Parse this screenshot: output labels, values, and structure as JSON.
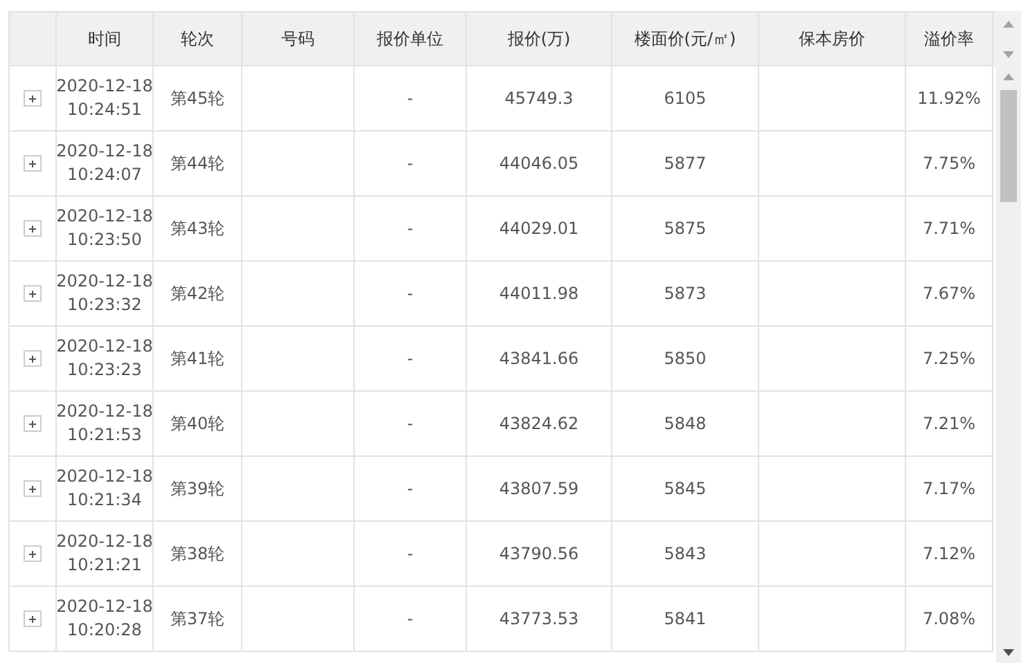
{
  "table": {
    "columns": [
      "时间",
      "轮次",
      "号码",
      "报价单位",
      "报价(万)",
      "楼面价(元/㎡)",
      "保本房价",
      "溢价率"
    ],
    "rows": [
      {
        "expanded": false,
        "time": "2020-12-18\n10:24:51",
        "round": "第45轮",
        "bidder": "-",
        "bid": "45749.3",
        "floor_price": "6105",
        "premium": "11.92%"
      },
      {
        "expanded": false,
        "time": "2020-12-18\n10:24:07",
        "round": "第44轮",
        "bidder": "-",
        "bid": "44046.05",
        "floor_price": "5877",
        "premium": "7.75%"
      },
      {
        "expanded": false,
        "time": "2020-12-18\n10:23:50",
        "round": "第43轮",
        "bidder": "-",
        "bid": "44029.01",
        "floor_price": "5875",
        "premium": "7.71%"
      },
      {
        "expanded": false,
        "time": "2020-12-18\n10:23:32",
        "round": "第42轮",
        "bidder": "-",
        "bid": "44011.98",
        "floor_price": "5873",
        "premium": "7.67%"
      },
      {
        "expanded": false,
        "time": "2020-12-18\n10:23:23",
        "round": "第41轮",
        "bidder": "-",
        "bid": "43841.66",
        "floor_price": "5850",
        "premium": "7.25%"
      },
      {
        "expanded": false,
        "time": "2020-12-18\n10:21:53",
        "round": "第40轮",
        "bidder": "-",
        "bid": "43824.62",
        "floor_price": "5848",
        "premium": "7.21%"
      },
      {
        "expanded": false,
        "time": "2020-12-18\n10:21:34",
        "round": "第39轮",
        "bidder": "-",
        "bid": "43807.59",
        "floor_price": "5845",
        "premium": "7.17%"
      },
      {
        "expanded": false,
        "time": "2020-12-18\n10:21:21",
        "round": "第38轮",
        "bidder": "-",
        "bid": "43790.56",
        "floor_price": "5843",
        "premium": "7.12%"
      },
      {
        "expanded": false,
        "time": "2020-12-18\n10:20:28",
        "round": "第37轮",
        "bidder": "-",
        "bid": "43773.53",
        "floor_price": "5841",
        "premium": "7.08%"
      }
    ]
  }
}
